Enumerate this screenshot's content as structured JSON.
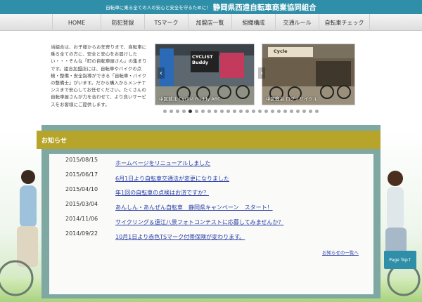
{
  "header": {
    "tagline": "自転車に乗る全ての人の安心と安全を守るために！",
    "title": "静岡県西遠自転車商業協同組合",
    "bg_color": "#2f8fa8"
  },
  "nav": {
    "items": [
      {
        "label": "HOME"
      },
      {
        "label": "防犯登録"
      },
      {
        "label": "TSマーク"
      },
      {
        "label": "加盟店一覧"
      },
      {
        "label": "組織構成"
      },
      {
        "label": "交通ルール"
      },
      {
        "label": "自転車チェック"
      }
    ]
  },
  "intro": {
    "text": "当組合は、お子様からお年寄りまで、自転車に乗る全ての方に、安全と安心をお届けしたい・・・そんな「町の自転車屋さん」の集まりです。組合加盟店には、自転車やバイクの点検・整備・安全指導ができる「自転車・バイクの整備士」がいます。だから購入からメンテナンスまで安心してお任せください。たくさんの自転車屋さんが力を合わせて、より良いサービスをお客様にご提供します。"
  },
  "carousel": {
    "slides": [
      {
        "caption": "中区城北 Cyclist Buddy ABC",
        "sign_text": "CYCLIST Buddy"
      },
      {
        "caption": "中区鍛冶 ログノサイクル",
        "sign_text": "Cycle"
      }
    ],
    "dot_count": 25,
    "active_dot": 4
  },
  "news": {
    "heading": "お知らせ",
    "items": [
      {
        "date": "2015/08/15",
        "title": "ホームページをリニューアルしました"
      },
      {
        "date": "2015/06/17",
        "title": "6月1日より自転車交通法が変更になりました"
      },
      {
        "date": "2015/04/10",
        "title": "年1回の自転車の点検はお済ですか？"
      },
      {
        "date": "2015/03/04",
        "title": "あんしん・あんぜん自転車　静岡県キャンペーン　スタート！"
      },
      {
        "date": "2014/11/06",
        "title": "サイクリング＆遠江八景フォトコンテストに応募してみませんか？"
      },
      {
        "date": "2014/09/22",
        "title": "10月1日より赤色TSマーク付帯保険が変わります。"
      }
    ],
    "more_label": "お知らせの一覧へ",
    "heading_color": "#b6a52a",
    "frame_color": "#7fa8a3"
  },
  "page_top_label": "Page Top↑"
}
